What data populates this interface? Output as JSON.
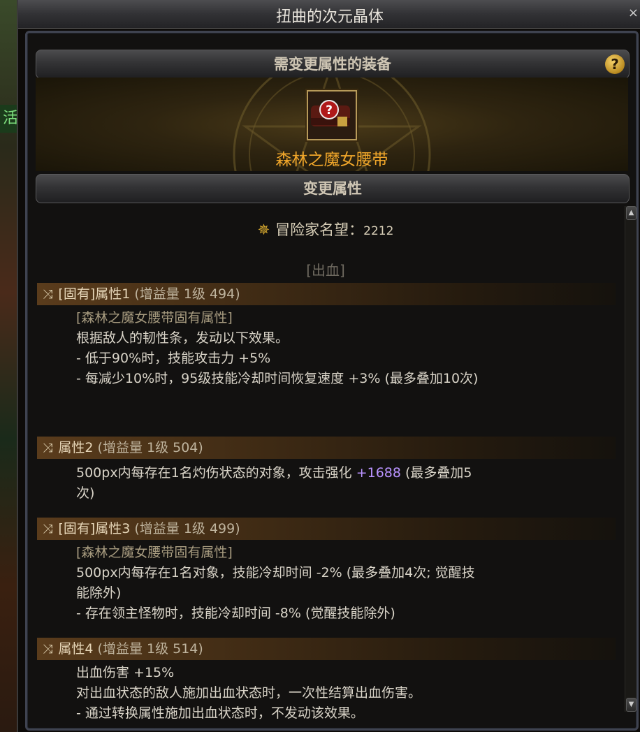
{
  "window": {
    "title": "扭曲的次元晶体",
    "close": "×"
  },
  "background": {
    "side_tag": "活"
  },
  "equipment_section": {
    "header": "需变更属性的装备",
    "help": "?",
    "item_icon": "question-mark-belt-icon",
    "item_name": "森林之魔女腰带"
  },
  "change_section": {
    "header": "变更属性",
    "fame_icon": "fame-crest-icon",
    "fame_label": "冒险家名望",
    "fame_sep": "：",
    "fame_value": "2212",
    "category": "[出血]"
  },
  "attributes": [
    {
      "title": "[固有]属性1",
      "gain": "(增益量 1级 494)",
      "inherent_note": "[森林之魔女腰带固有属性]",
      "lines": [
        "根据敌人的韧性条，发动以下效果。",
        "- 低于90%时，技能攻击力 +5%",
        "- 每减少10%时，95级技能冷却时间恢复速度 +3% (最多叠加10次)"
      ]
    },
    {
      "title": "属性2",
      "gain": "(增益量 1级 504)",
      "line1_pre": "500px内每存在1名灼伤状态的对象，攻击强化 ",
      "line1_highlight": "+1688",
      "line1_post": " (最多叠加5",
      "line2": "次)"
    },
    {
      "title": "[固有]属性3",
      "gain": "(增益量 1级 499)",
      "inherent_note": "[森林之魔女腰带固有属性]",
      "lines": [
        "500px内每存在1名对象，技能冷却时间 -2% (最多叠加4次; 觉醒技",
        "能除外)",
        "- 存在领主怪物时，技能冷却时间 -8% (觉醒技能除外)"
      ]
    },
    {
      "title": "属性4",
      "gain": "(增益量 1级 514)",
      "lines": [
        "出血伤害 +15%",
        "对出血状态的敌人施加出血状态时，一次性结算出血伤害。",
        "- 通过转换属性施加出血状态时，不发动该效果。"
      ]
    }
  ],
  "colors": {
    "item_name": "#f0a62a",
    "highlight": "#b993ff",
    "inherent": "#a89c80"
  }
}
